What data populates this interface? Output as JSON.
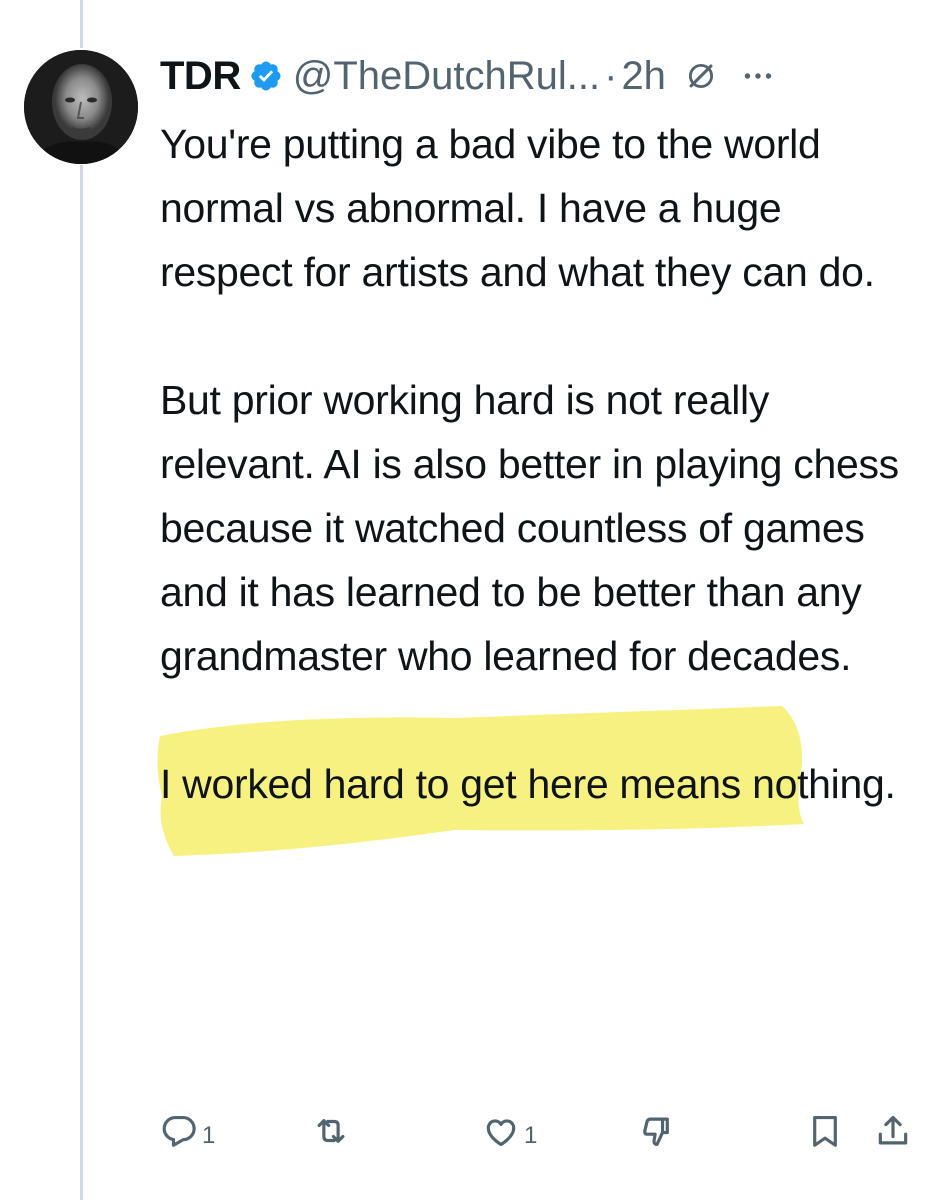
{
  "post": {
    "author_name": "TDR",
    "handle": "@TheDutchRul...",
    "separator": "·",
    "time": "2h",
    "paragraphs": [
      "You're putting a bad vibe to the world normal vs abnormal. I have a huge respect for artists and what they can do.",
      "But prior working hard is not really relevant. AI is also better in playing chess because it watched countless of games and it has learned to be better than any grandmaster who learned for decades.",
      "I worked hard to get here means nothing."
    ],
    "highlight_color": "#f7f07a"
  },
  "actions": {
    "reply_count": "1",
    "like_count": "1"
  },
  "colors": {
    "text": "#0f1419",
    "secondary": "#536471",
    "verified": "#1d9bf0",
    "thread_line": "#cfd9de"
  },
  "icons": [
    "verified-badge-icon",
    "grok-icon",
    "more-icon",
    "reply-icon",
    "retweet-icon",
    "like-icon",
    "dislike-icon",
    "bookmark-icon",
    "share-icon"
  ]
}
